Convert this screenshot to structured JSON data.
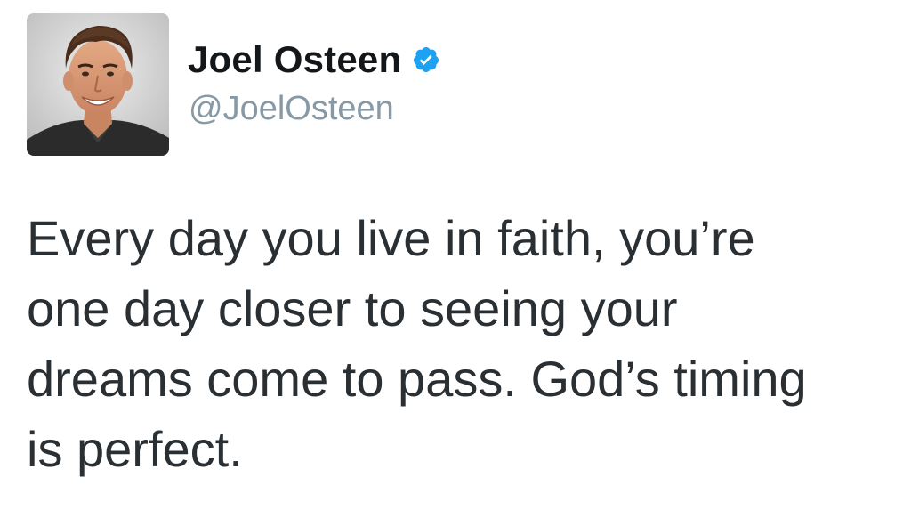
{
  "author": {
    "display_name": "Joel Osteen",
    "handle": "@JoelOsteen",
    "verified": true,
    "avatar_icon": "profile-photo"
  },
  "tweet": {
    "text": "Every day you live in faith, you’re\none day closer to seeing your\ndreams come to pass. God’s timing\nis perfect."
  },
  "colors": {
    "name": "#14171a",
    "handle": "#8899a6",
    "body_text": "#292f33",
    "verified_badge": "#1da1f2"
  }
}
